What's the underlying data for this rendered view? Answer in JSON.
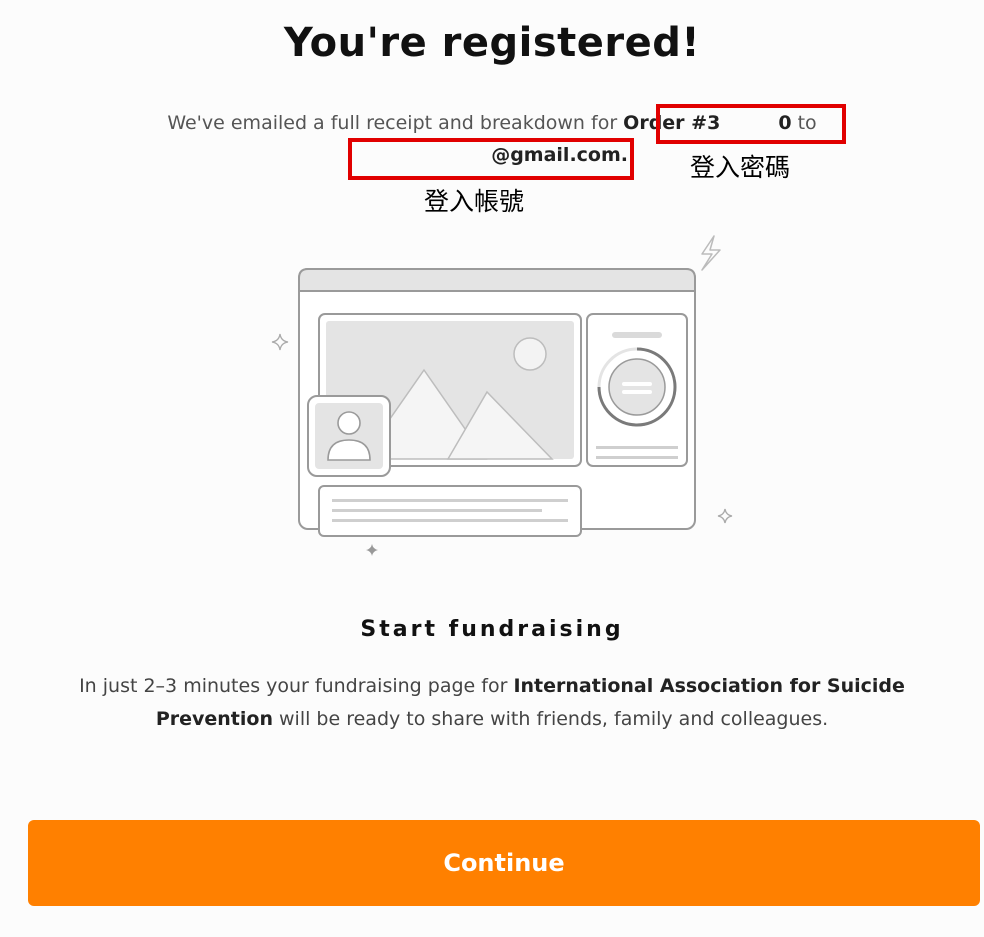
{
  "page": {
    "title": "You're registered!",
    "receipt_text": "We've emailed a full receipt and breakdown for ",
    "order_start": "Order #3",
    "order_end": "0",
    "to_text": " to",
    "email": "@gmail.com.",
    "annotation_password": "登入密碼",
    "annotation_account": "登入帳號"
  },
  "section": {
    "heading": "Start fundraising",
    "desc_before": "In just 2–3 minutes your fundraising page for ",
    "charity": "International Association for Suicide Prevention",
    "desc_after": " will be ready to share with friends, family and colleagues."
  },
  "actions": {
    "continue_label": "Continue"
  },
  "colors": {
    "accent": "#ff8000",
    "annotation_box": "#e10000"
  },
  "illustration": {
    "icons": [
      "browser-window-icon",
      "image-placeholder-icon",
      "user-avatar-icon",
      "progress-ring-icon",
      "lightning-icon",
      "sparkle-icon"
    ]
  }
}
